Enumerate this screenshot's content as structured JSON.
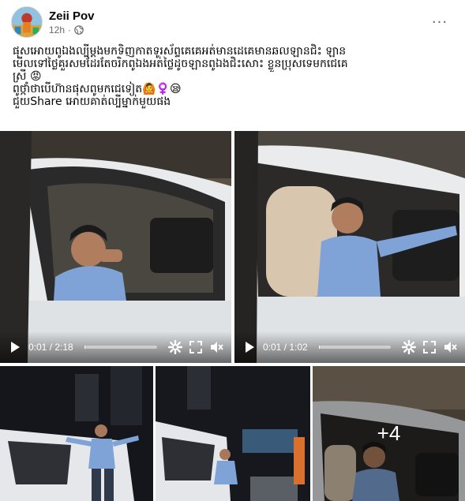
{
  "post": {
    "author": "Zeii Pov",
    "time": "12h",
    "separator": "·",
    "privacy_icon": "globe-icon",
    "more_icon": "more-icon",
    "more_glyph": "···",
    "caption": [
      "ផុសអោយពូឯងល្បីម្តងមកទិញកាតទូរស័ព្ទគេគេអត់មានដេគេមានឆលឡានជិះ ឡាន",
      "មើលទៅថ្លៃគួរសមដែរតែចរិកពូឯងអត់ថ្លៃដូចឡានពូឯងជិះសោះ ខ្លួនប្រុសទេមកជេគេ",
      "ស្រី 😡",
      "ពូថ្កាំថាបើហ៊ានផុសពូមកជេទៀត🙆‍♀️😪",
      "ជួយShare អោយគាត់ល្បីម្នាក់មួយផង"
    ]
  },
  "videos": [
    {
      "time": "0:01 / 2:18",
      "progress": 0.008
    },
    {
      "time": "0:01 / 1:02",
      "progress": 0.016
    }
  ],
  "photos": {
    "more_count": "+4"
  },
  "colors": {
    "text_primary": "#050505",
    "text_secondary": "#65676b",
    "video_controls": "#ffffff"
  }
}
